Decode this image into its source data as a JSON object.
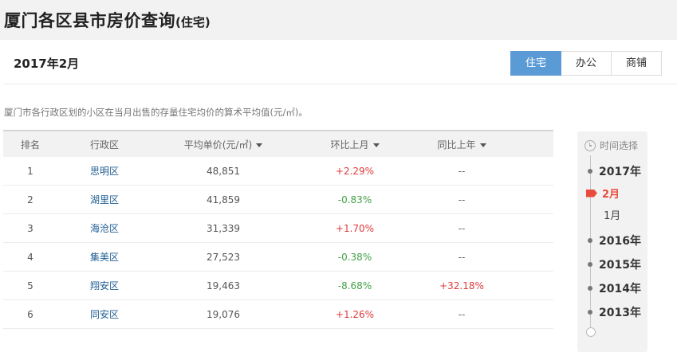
{
  "page": {
    "title": "厦门各区县市房价查询",
    "title_suffix": "(住宅)"
  },
  "period": "2017年2月",
  "type_tabs": [
    {
      "label": "住宅",
      "active": true
    },
    {
      "label": "办公",
      "active": false
    },
    {
      "label": "商铺",
      "active": false
    }
  ],
  "note": "厦门市各行政区划的小区在当月出售的存量住宅均价的算术平均值(元/㎡)。",
  "table": {
    "headers": {
      "rank": "排名",
      "district": "行政区",
      "avg_price": "平均单价(元/㎡)",
      "mom": "环比上月",
      "yoy": "同比上年"
    },
    "rows": [
      {
        "rank": "1",
        "district": "思明区",
        "price": "48,851",
        "mom": "+2.29%",
        "yoy": "--"
      },
      {
        "rank": "2",
        "district": "湖里区",
        "price": "41,859",
        "mom": "-0.83%",
        "yoy": "--"
      },
      {
        "rank": "3",
        "district": "海沧区",
        "price": "31,339",
        "mom": "+1.70%",
        "yoy": "--"
      },
      {
        "rank": "4",
        "district": "集美区",
        "price": "27,523",
        "mom": "-0.38%",
        "yoy": "--"
      },
      {
        "rank": "5",
        "district": "翔安区",
        "price": "19,463",
        "mom": "-8.68%",
        "yoy": "+32.18%"
      },
      {
        "rank": "6",
        "district": "同安区",
        "price": "19,076",
        "mom": "+1.26%",
        "yoy": "--"
      }
    ]
  },
  "timeline": {
    "header": "时间选择",
    "items": [
      {
        "label": "2017年",
        "kind": "year"
      },
      {
        "label": "2月",
        "kind": "month",
        "active": true
      },
      {
        "label": "1月",
        "kind": "month",
        "active": false
      },
      {
        "label": "2016年",
        "kind": "year"
      },
      {
        "label": "2015年",
        "kind": "year"
      },
      {
        "label": "2014年",
        "kind": "year"
      },
      {
        "label": "2013年",
        "kind": "year"
      }
    ]
  },
  "colors": {
    "accent": "#5b9bd5",
    "positive": "#e03a3a",
    "negative": "#43a047",
    "link": "#1f5e93",
    "active_month": "#e84c3d"
  },
  "icons": {
    "sort": "caret-down-icon",
    "timeline": "clock-icon",
    "selected_month": "flag-icon"
  }
}
